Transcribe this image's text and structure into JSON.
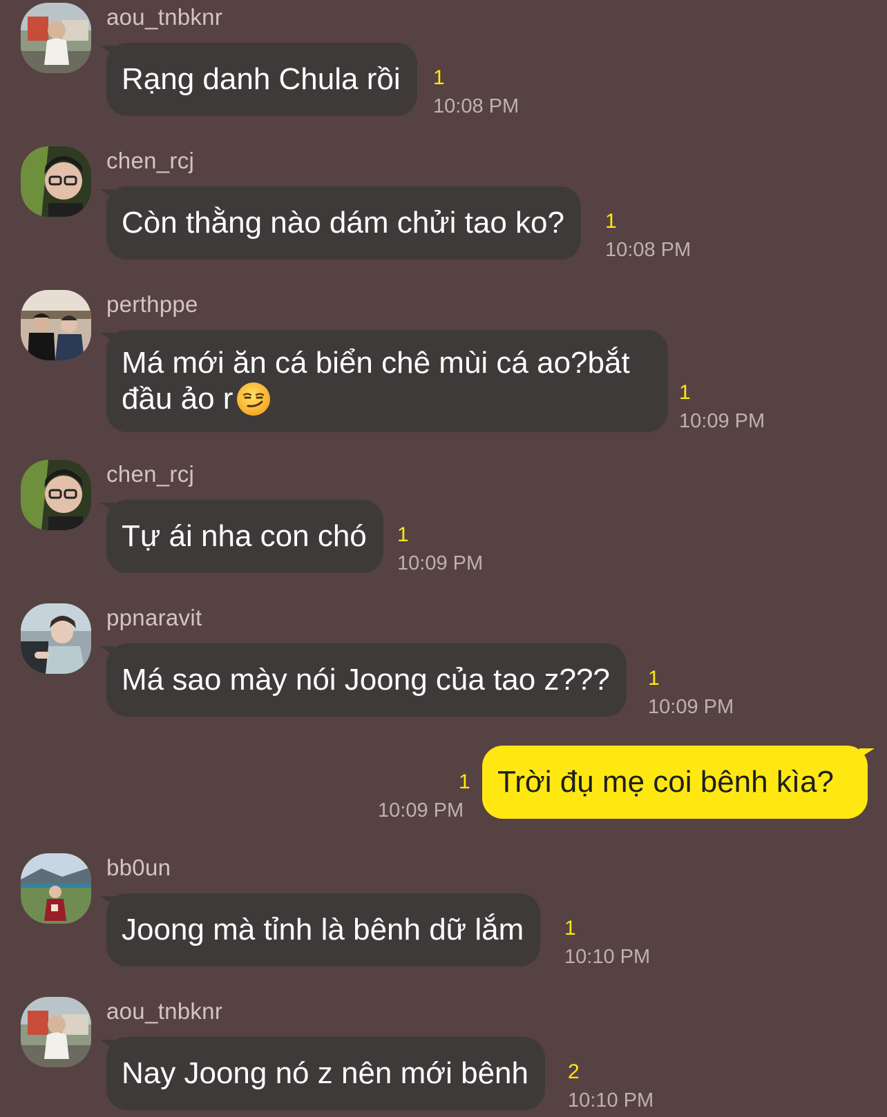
{
  "messages": [
    {
      "sender": "aou_tnbknr",
      "text": "Rạng danh Chula rồi",
      "unread": "1",
      "time": "10:08 PM",
      "avatar": "avatar-aou"
    },
    {
      "sender": "chen_rcj",
      "text": "Còn thằng nào dám chửi tao ko?",
      "unread": "1",
      "time": "10:08 PM",
      "avatar": "avatar-chen"
    },
    {
      "sender": "perthppe",
      "text_line1": "Má mới ăn cá biển chê mùi cá ao?bắt",
      "text_line2": "đầu ảo r",
      "emoji": "smirk-emoji",
      "unread": "1",
      "time": "10:09 PM",
      "avatar": "avatar-perth"
    },
    {
      "sender": "chen_rcj",
      "text": "Tự ái nha con chó",
      "unread": "1",
      "time": "10:09 PM",
      "avatar": "avatar-chen"
    },
    {
      "sender": "ppnaravit",
      "text": "Má sao mày nói Joong của tao z???",
      "unread": "1",
      "time": "10:09 PM",
      "avatar": "avatar-ppnaravit"
    },
    {
      "sender": "",
      "text": "Trời đụ mẹ coi bênh kìa?",
      "unread": "1",
      "time": "10:09 PM",
      "mine": true
    },
    {
      "sender": "bb0un",
      "text": "Joong mà tỉnh là bênh dữ lắm",
      "unread": "1",
      "time": "10:10 PM",
      "avatar": "avatar-bb0un"
    },
    {
      "sender": "aou_tnbknr",
      "text": "Nay Joong nó z nên mới bênh",
      "unread": "2",
      "time": "10:10 PM",
      "avatar": "avatar-aou"
    }
  ],
  "colors": {
    "background": "#564242",
    "bubble_other": "#3f3a3a",
    "bubble_mine": "#ffe812",
    "unread": "#ffe812"
  }
}
